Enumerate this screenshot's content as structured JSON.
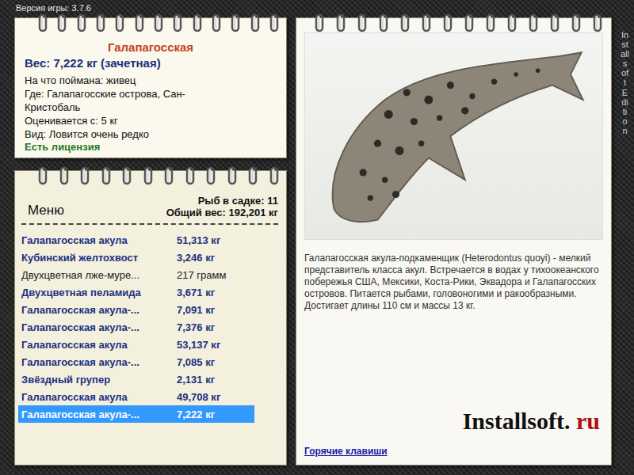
{
  "version": "Версия игры: 3.7.6",
  "fish_card": {
    "title": "Галапагосская",
    "weight": "Вес: 7,222 кг (зачетная)",
    "details": [
      "На что поймана: живец",
      "Где: Галапагосские острова, Сан-Кристобаль",
      "Оценивается с: 5 кг",
      "Вид: Ловится очень редко"
    ],
    "license": "Есть лицензия"
  },
  "menu": {
    "title": "Меню",
    "count": "Рыб в садке: 11",
    "total": "Общий вес: 192,201 кг",
    "rows": [
      {
        "name": "Галапагосская акула",
        "weight": "51,313 кг",
        "counted": true,
        "selected": false
      },
      {
        "name": "Кубинский желтохвост",
        "weight": "3,246 кг",
        "counted": true,
        "selected": false
      },
      {
        "name": "Двухцветная лже-муре...",
        "weight": "217 грамм",
        "counted": false,
        "selected": false
      },
      {
        "name": "Двухцветная пеламида",
        "weight": "3,671 кг",
        "counted": true,
        "selected": false
      },
      {
        "name": "Галапагосская акула-...",
        "weight": "7,091 кг",
        "counted": true,
        "selected": false
      },
      {
        "name": "Галапагосская акула-...",
        "weight": "7,376 кг",
        "counted": true,
        "selected": false
      },
      {
        "name": "Галапагосская акула",
        "weight": "53,137 кг",
        "counted": true,
        "selected": false
      },
      {
        "name": "Галапагосская акула-...",
        "weight": "7,085 кг",
        "counted": true,
        "selected": false
      },
      {
        "name": "Звёздный групер",
        "weight": "2,131 кг",
        "counted": true,
        "selected": false
      },
      {
        "name": "Галапагосская акула",
        "weight": "49,708 кг",
        "counted": true,
        "selected": false
      },
      {
        "name": "Галапагосская акула-...",
        "weight": "7,222 кг",
        "counted": true,
        "selected": true
      }
    ]
  },
  "description": "Галапагосская акула-подкаменщик (Heterodontus quoyi) - мелкий представитель класса акул. Встречается в водах у тихоокеанского побережья США, Мексики, Коста-Рики, Эквадора и Галапагосских островов. Питается рыбами, головоногими и ракообразными. Достигает длины 110 см и массы 13 кг.",
  "logo": {
    "name": "Installsoft.",
    "tld": " ru"
  },
  "hotkeys_link": "Горячие клавиши",
  "side_label": "Installsoft Edition"
}
